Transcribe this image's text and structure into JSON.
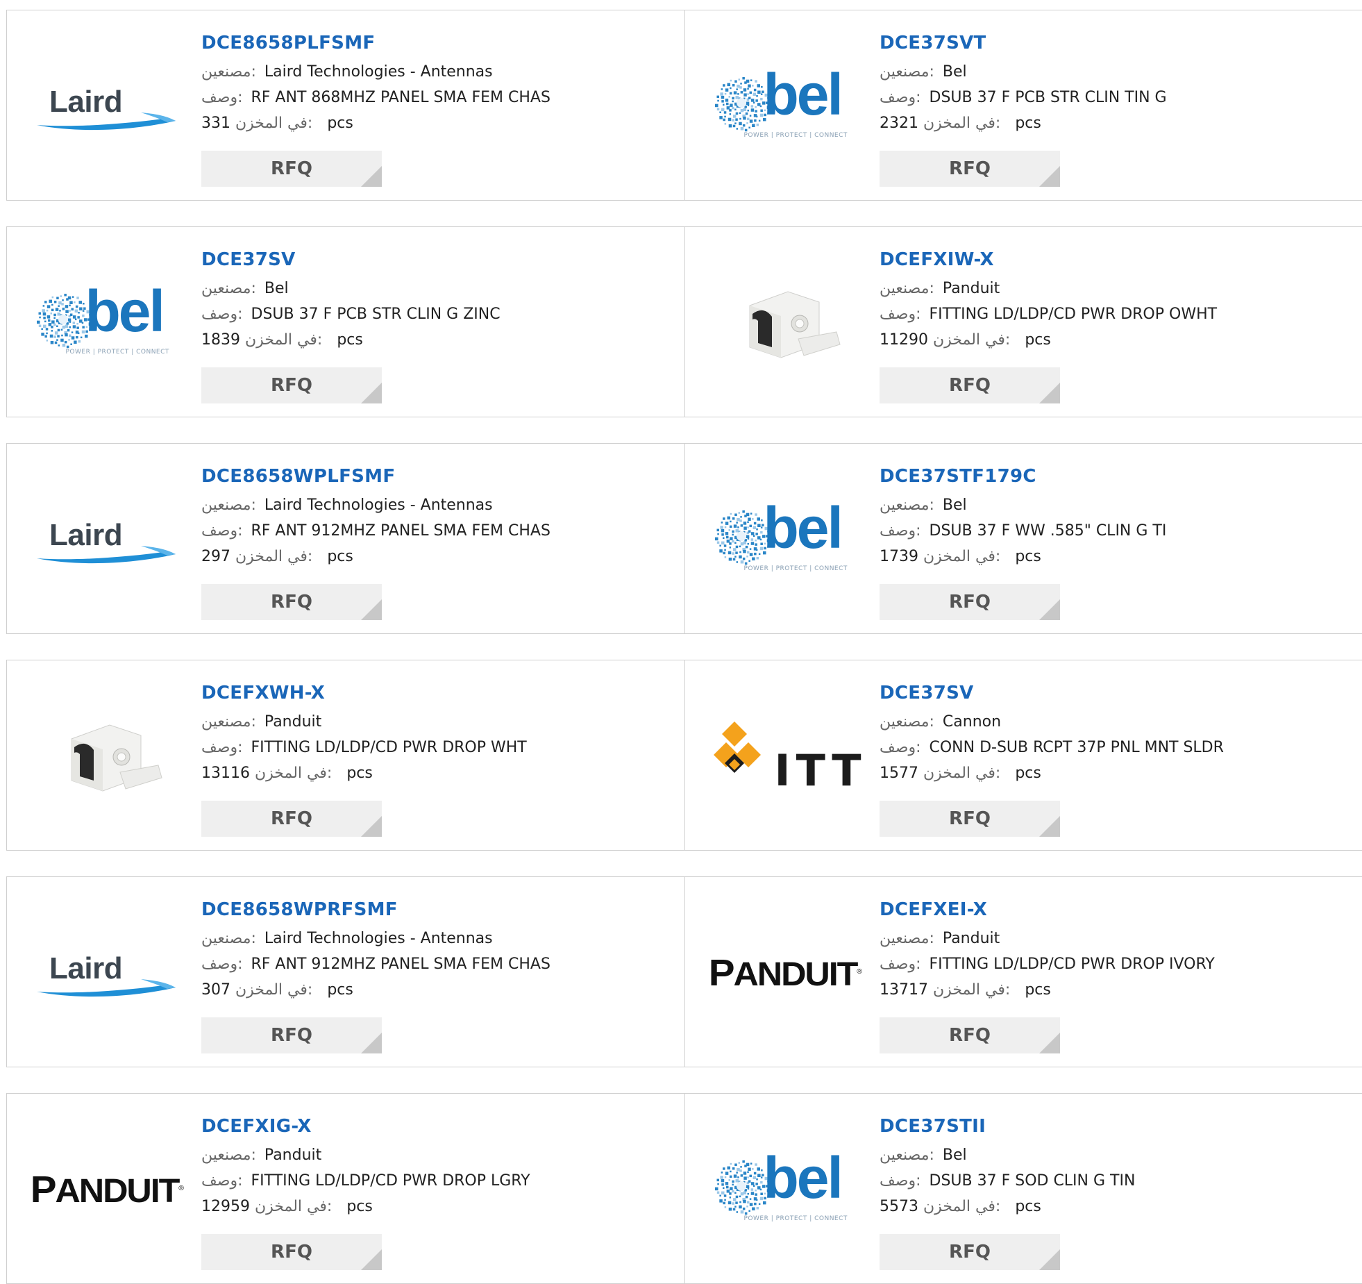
{
  "labels": {
    "manufacturer": "مصنعين:",
    "description": "وصف:",
    "stock": "في المخزن:",
    "unit": "pcs",
    "rfq": "RFQ"
  },
  "products": [
    {
      "part": "DCE8658PLFSMF",
      "manufacturer": "Laird Technologies - Antennas",
      "description": "RF ANT 868MHZ PANEL SMA FEM CHAS",
      "stock": "331",
      "logo": "Laird"
    },
    {
      "part": "DCE37SVT",
      "manufacturer": "Bel",
      "description": "DSUB 37 F PCB STR CLIN TIN G",
      "stock": "2321",
      "logo": "bel"
    },
    {
      "part": "DCE37SV",
      "manufacturer": "Bel",
      "description": "DSUB 37 F PCB STR CLIN G ZINC",
      "stock": "1839",
      "logo": "bel"
    },
    {
      "part": "DCEFXIW-X",
      "manufacturer": "Panduit",
      "description": "FITTING LD/LDP/CD PWR DROP OWHT",
      "stock": "11290",
      "logo": "fitting-image"
    },
    {
      "part": "DCE8658WPLFSMF",
      "manufacturer": "Laird Technologies - Antennas",
      "description": "RF ANT 912MHZ PANEL SMA FEM CHAS",
      "stock": "297",
      "logo": "Laird"
    },
    {
      "part": "DCE37STF179C",
      "manufacturer": "Bel",
      "description": "DSUB 37 F WW .585\" CLIN G TI",
      "stock": "1739",
      "logo": "bel"
    },
    {
      "part": "DCEFXWH-X",
      "manufacturer": "Panduit",
      "description": "FITTING LD/LDP/CD PWR DROP WHT",
      "stock": "13116",
      "logo": "fitting-image"
    },
    {
      "part": "DCE37SV",
      "manufacturer": "Cannon",
      "description": "CONN D-SUB RCPT 37P PNL MNT SLDR",
      "stock": "1577",
      "logo": "ITT"
    },
    {
      "part": "DCE8658WPRFSMF",
      "manufacturer": "Laird Technologies - Antennas",
      "description": "RF ANT 912MHZ PANEL SMA FEM CHAS",
      "stock": "307",
      "logo": "Laird"
    },
    {
      "part": "DCEFXEI-X",
      "manufacturer": "Panduit",
      "description": "FITTING LD/LDP/CD PWR DROP IVORY",
      "stock": "13717",
      "logo": "PANDUIT"
    },
    {
      "part": "DCEFXIG-X",
      "manufacturer": "Panduit",
      "description": "FITTING LD/LDP/CD PWR DROP LGRY",
      "stock": "12959",
      "logo": "PANDUIT"
    },
    {
      "part": "DCE37STII",
      "manufacturer": "Bel",
      "description": "DSUB 37 F SOD CLIN G TIN",
      "stock": "5573",
      "logo": "bel"
    }
  ],
  "logos": {
    "bel_tagline": "POWER | PROTECT | CONNECT"
  },
  "colors": {
    "part_link": "#1a66b8",
    "bel_blue": "#1b76bd",
    "itt_orange": "#f4a21c",
    "laird_swoosh": "#1f8fd6",
    "rfq_bg": "#efefef"
  }
}
